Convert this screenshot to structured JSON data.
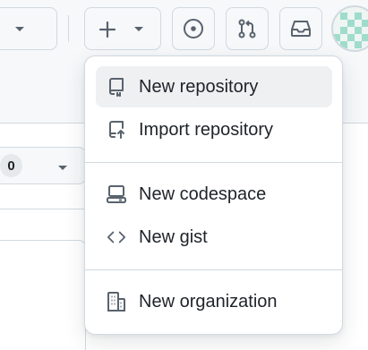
{
  "header": {
    "buttons": [
      {
        "name": "copilot-button",
        "icon": "copilot-icon"
      },
      {
        "name": "create-new-button",
        "icon": "plus-icon",
        "caret": "chevron-down-icon"
      },
      {
        "name": "issues-button",
        "icon": "issue-opened-icon"
      },
      {
        "name": "pull-requests-button",
        "icon": "git-pull-request-icon"
      },
      {
        "name": "inbox-button",
        "icon": "inbox-icon"
      }
    ],
    "avatar": "user-avatar"
  },
  "background": {
    "count": "0"
  },
  "menu": {
    "items": [
      {
        "label": "New repository",
        "icon": "repo-icon",
        "active": true
      },
      {
        "label": "Import repository",
        "icon": "repo-push-icon"
      },
      {
        "label": "New codespace",
        "icon": "codespaces-icon"
      },
      {
        "label": "New gist",
        "icon": "code-icon"
      },
      {
        "label": "New organization",
        "icon": "organization-icon"
      }
    ]
  },
  "colors": {
    "text": "#1f2328",
    "muted": "#59636e",
    "border": "#d1d9e0",
    "hover": "#eef0f2",
    "header_bg": "#f6f8fa"
  }
}
